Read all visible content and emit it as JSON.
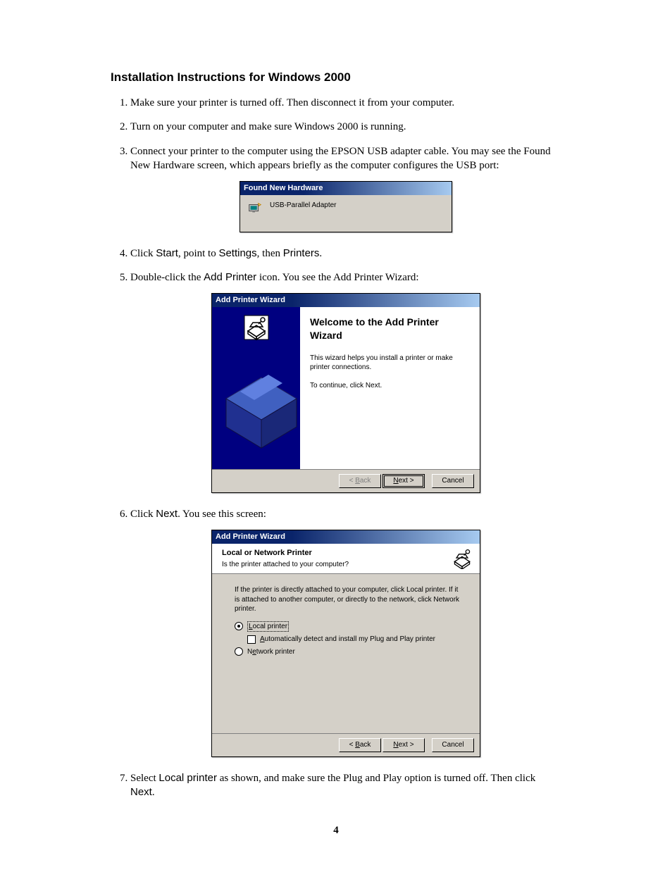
{
  "heading": "Installation Instructions for Windows 2000",
  "steps": {
    "s1": "Make sure your printer is turned off. Then disconnect it from your computer.",
    "s2": "Turn on your computer and make sure Windows 2000 is running.",
    "s3": "Connect your printer to the computer using the EPSON USB adapter cable. You may see the Found New Hardware screen, which appears briefly as the computer configures the USB port:",
    "s4_pre": "Click ",
    "s4_start": "Start",
    "s4_mid1": ", point to ",
    "s4_settings": "Settings",
    "s4_mid2": ", then ",
    "s4_printers": "Printers",
    "s4_post": ".",
    "s5_pre": "Double-click the ",
    "s5_add": "Add Printer",
    "s5_post": " icon. You see the Add Printer Wizard:",
    "s6_pre": "Click ",
    "s6_next": "Next",
    "s6_post": ". You see this screen:",
    "s7_pre": "Select ",
    "s7_local": "Local printer",
    "s7_mid": " as shown, and make sure the Plug and Play option is turned off. Then click ",
    "s7_next": "Next",
    "s7_post": "."
  },
  "fnh": {
    "title": "Found New Hardware",
    "text": "USB-Parallel Adapter"
  },
  "wiz1": {
    "title": "Add Printer Wizard",
    "heading": "Welcome to the Add Printer Wizard",
    "text1": "This wizard helps you install a printer or make printer connections.",
    "text2": "To continue, click Next.",
    "back": "< Back",
    "next": "Next >",
    "cancel": "Cancel"
  },
  "wiz2": {
    "title": "Add Printer Wizard",
    "head_title": "Local or Network Printer",
    "head_sub": "Is the printer attached to your computer?",
    "instr": "If the printer is directly attached to your computer, click Local printer. If it is attached to another computer, or directly to the network, click Network printer.",
    "opt_local": "Local printer",
    "opt_auto": "Automatically detect and install my Plug and Play printer",
    "opt_net": "Network printer",
    "back": "< Back",
    "next": "Next >",
    "cancel": "Cancel"
  },
  "page_number": "4"
}
